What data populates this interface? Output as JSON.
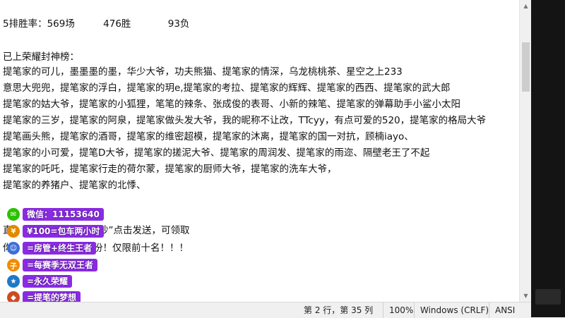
{
  "stats": {
    "rate": "5排胜率：569场",
    "wins": "476胜",
    "losses": "93负"
  },
  "honor_header": "已上荣耀封神榜：",
  "honor_lines": [
    "提笔家的可儿，墨墨墨的墨，华少大爷，功夫熊猫、提笔家的情深，乌龙桃桃茶、星空之上233",
    "意思大兜兜，提笔家的浮白，提笔家的玥e,提笔家的考拉、提笔家的辉辉、提笔家的西西、提笔家的武大郎",
    "提笔家的姑大爷，提笔家的小狐狸，笔笔的辣条、张成俊的表哥、小新的辣笔、提笔家的弹幕助手小鲨小太阳",
    "提笔家的三岁，提笔家的阿泉，提笔家做头发大爷，我的昵称不让改，TTcyy，有点可爱的520，提笔家的格局大爷",
    "提笔画头熊，提笔家的酒哥，提笔家的维密超模，提笔家的沐离，提笔家的国一对抗，顾楠iayo、",
    "提笔家的小可爱，提笔D大爷，提笔家的搓泥大爷、提笔家的周润发、提笔家的雨迩、隔壁老王了不起",
    "提笔家的吒吒，提笔家行走的荷尔蒙，提笔家的厨师大爷，提笔家的洗车大爷，",
    "提笔家的养猪户、提笔家的北悸、"
  ],
  "partial_lines": {
    "line1_start": "直",
    "line1_end": "吵”点击发送，可领取",
    "line2_start": "你",
    "line2_end": "份！仅限前十名！！！"
  },
  "overlay": [
    {
      "icon": "wechat-icon",
      "color": "#2dc100",
      "glyph": "✉",
      "label": "微信：11153640"
    },
    {
      "icon": "coin-icon",
      "color": "#e08a00",
      "glyph": "¥",
      "label": "¥100=包车两小时"
    },
    {
      "icon": "avatar-icon",
      "color": "#3b6fd8",
      "glyph": "☺",
      "label": "=房管+终生王者"
    },
    {
      "icon": "badge-icon",
      "color": "#f08c00",
      "glyph": "子",
      "label": "=每赛季无双王者"
    },
    {
      "icon": "medal-icon",
      "color": "#1e78c8",
      "glyph": "★",
      "label": "=永久荣耀"
    },
    {
      "icon": "crest-icon",
      "color": "#d04a20",
      "glyph": "◆",
      "label": "=提笔的梦想"
    }
  ],
  "status": {
    "position": "第 2 行，第 35 列",
    "zoom": "100%",
    "line_ending": "Windows (CRLF)",
    "encoding": "ANSI"
  }
}
